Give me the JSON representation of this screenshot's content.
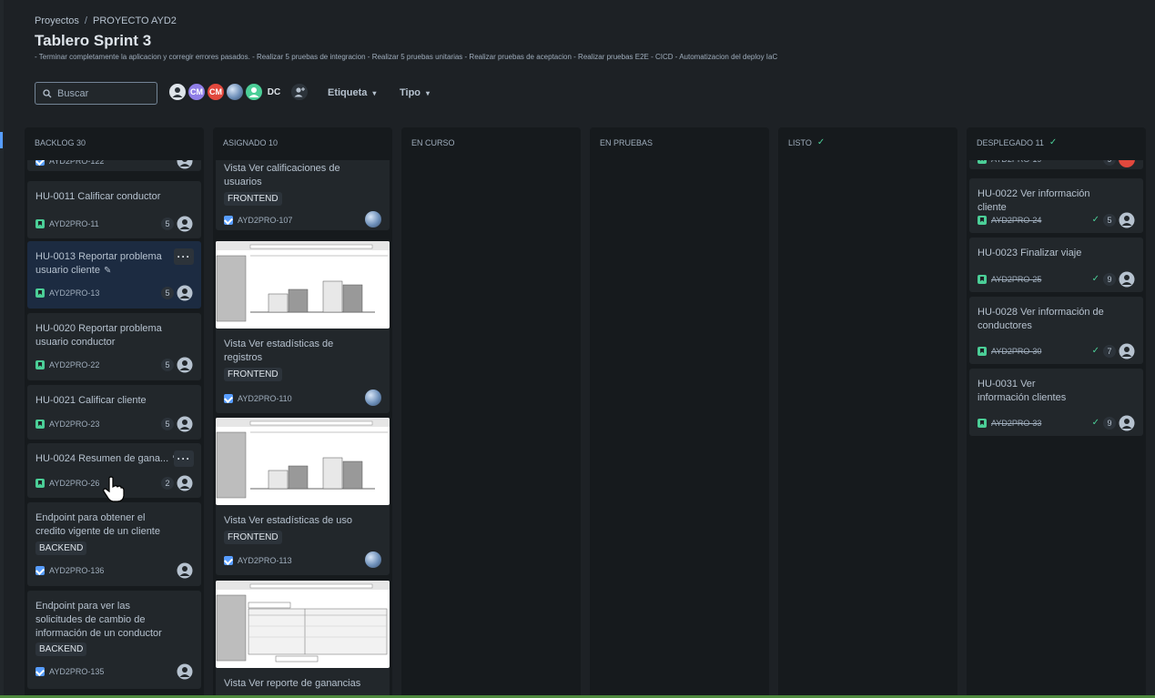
{
  "breadcrumb": {
    "root": "Proyectos",
    "project": "PROYECTO AYD2"
  },
  "board": {
    "title": "Tablero Sprint 3",
    "goal": "- Terminar completamente la aplicacion y corregir errores pasados. - Realizar 5 pruebas de integracion - Realizar 5 pruebas unitarias - Realizar pruebas de aceptacion - Realizar pruebas E2E - CICD - Automatizacion del deploy IaC"
  },
  "toolbar": {
    "search_placeholder": "Buscar",
    "avatars": [
      {
        "initials": "",
        "color": "#dee4ea",
        "icon": "user-icon"
      },
      {
        "initials": "CM",
        "color": "#8f7ee7"
      },
      {
        "initials": "CM",
        "color": "#e2483d"
      },
      {
        "initials": "",
        "color": "#85b8ff",
        "icon": "photo-avatar"
      },
      {
        "initials": "",
        "color": "#4bce97",
        "icon": "user-icon"
      },
      {
        "initials": "DC",
        "color": "transparent"
      }
    ],
    "filter_label": "Etiqueta",
    "filter_type": "Tipo"
  },
  "columns": {
    "backlog": "BACKLOG 30",
    "asignado": "ASIGNADO 10",
    "en_curso": "EN CURSO",
    "en_pruebas": "EN PRUEBAS",
    "listo": "LISTO",
    "desplegado": "DESPLEGADO 11"
  },
  "backlog_cards": [
    {
      "key": "AYD2PRO-122",
      "title": ""
    },
    {
      "title": "HU-0011 Calificar conductor",
      "key": "AYD2PRO-11",
      "points": "5"
    },
    {
      "title": "HU-0013 Reportar problema usuario cliente",
      "key": "AYD2PRO-13",
      "points": "5"
    },
    {
      "title": "HU-0020 Reportar problema usuario conductor",
      "key": "AYD2PRO-22",
      "points": "5"
    },
    {
      "title": "HU-0021 Calificar cliente",
      "key": "AYD2PRO-23",
      "points": "5"
    },
    {
      "title": "HU-0024 Resumen de gana...",
      "key": "AYD2PRO-26",
      "points": "2"
    },
    {
      "title": "Endpoint para obtener el credito vigente de un cliente",
      "label": "BACKEND",
      "key": "AYD2PRO-136"
    },
    {
      "title": "Endpoint para ver las solicitudes de cambio de información de un conductor",
      "label": "BACKEND",
      "key": "AYD2PRO-135"
    }
  ],
  "asignado_cards": [
    {
      "title": "Vista Ver calificaciones de usuarios",
      "label": "FRONTEND",
      "key": "AYD2PRO-107"
    },
    {
      "title": "Vista Ver estadísticas de registros",
      "label": "FRONTEND",
      "key": "AYD2PRO-110"
    },
    {
      "title": "Vista Ver estadísticas de uso",
      "label": "FRONTEND",
      "key": "AYD2PRO-113"
    },
    {
      "title": "Vista Ver reporte de ganancias"
    }
  ],
  "desplegado_cards": [
    {
      "title": "HU-0022 Ver información cliente",
      "key": "AYD2PRO-24",
      "points": "5"
    },
    {
      "title": "HU-0023 Finalizar viaje",
      "key": "AYD2PRO-25",
      "points": "9"
    },
    {
      "title": "HU-0028 Ver información de conductores",
      "key": "AYD2PRO-30",
      "points": "7"
    },
    {
      "title": "HU-0031 Ver información clientes",
      "key": "AYD2PRO-33",
      "points": "9"
    }
  ],
  "desplegado_top_partial": {
    "key": "AYD2PRO-19",
    "points": "9"
  },
  "colors": {
    "background": "#1d2125",
    "column": "#161a1d",
    "card": "#22272b",
    "selected_card": "#1c2b41",
    "story": "#4bce97",
    "task": "#579dff"
  }
}
